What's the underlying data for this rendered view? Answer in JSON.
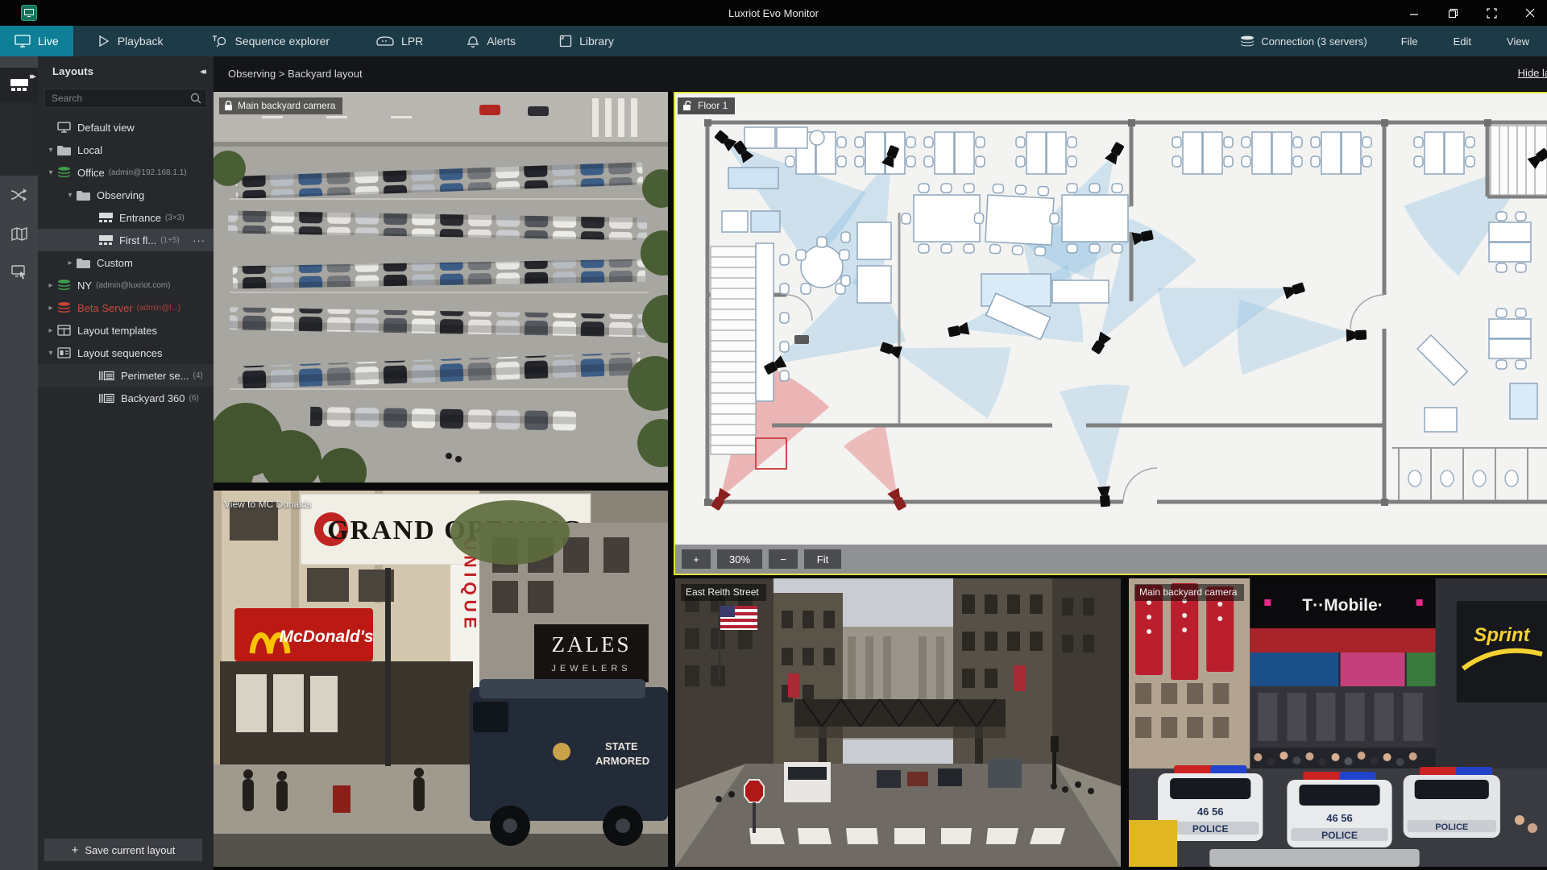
{
  "window": {
    "title": "Luxriot Evo Monitor"
  },
  "icons": {
    "arrow_down": "▾",
    "arrow_right": "▸",
    "collapse": "◂◂",
    "expand": "▸▸",
    "menu_dots": "···",
    "plus": "+",
    "minus": "−"
  },
  "nav": {
    "tabs": [
      {
        "label": "Live"
      },
      {
        "label": "Playback"
      },
      {
        "label": "Sequence explorer"
      },
      {
        "label": "LPR"
      },
      {
        "label": "Alerts"
      },
      {
        "label": "Library"
      }
    ],
    "connection": "Connection (3 servers)",
    "menus": [
      {
        "label": "File"
      },
      {
        "label": "Edit"
      },
      {
        "label": "View"
      }
    ]
  },
  "sidebar": {
    "title": "Layouts",
    "search_placeholder": "Search",
    "tree": [
      {
        "label": "Default view"
      },
      {
        "label": "Local"
      },
      {
        "label": "Office",
        "sub": "(admin@192.168.1.1)"
      },
      {
        "label": "Observing"
      },
      {
        "label": "Entrance",
        "sub": "(3×3)"
      },
      {
        "label": "First fl...",
        "sub": "(1+5)"
      },
      {
        "label": "Custom"
      },
      {
        "label": "NY",
        "sub": "(admin@luxriot.com)"
      },
      {
        "label": "Beta Server",
        "sub": "(admin@l...)"
      },
      {
        "label": "Layout templates"
      },
      {
        "label": "Layout sequences"
      },
      {
        "label": "Perimeter se...",
        "sub": "(4)"
      },
      {
        "label": "Backyard 360",
        "sub": "(6)"
      }
    ],
    "save_button": "Save current layout"
  },
  "breadcrumb": {
    "path": "Observing > Backyard layout",
    "hide_labels": "Hide labels"
  },
  "tiles": {
    "parking": {
      "label": "Main backyard camera"
    },
    "mcdonalds": {
      "label": "View to MC Donalds"
    },
    "floorplan": {
      "label": "Floor 1",
      "zoom_level": "30%",
      "fit_label": "Fit"
    },
    "street": {
      "label": "East Reith Street"
    },
    "square": {
      "label": "Main backyard camera"
    }
  },
  "scenes": {
    "mcdonalds": {
      "banner": "GRAND OPENING",
      "sign": "McDonald's",
      "unique": "UNIQUE",
      "jeweler": "ZALES",
      "jeweler2": "JEWELERS",
      "truck1": "STATE",
      "truck2": "ARMORED"
    },
    "square": {
      "tmobile": "T··Mobile·",
      "sprint": "Sprint",
      "police": "POLICE",
      "car_number": "46 56"
    }
  }
}
